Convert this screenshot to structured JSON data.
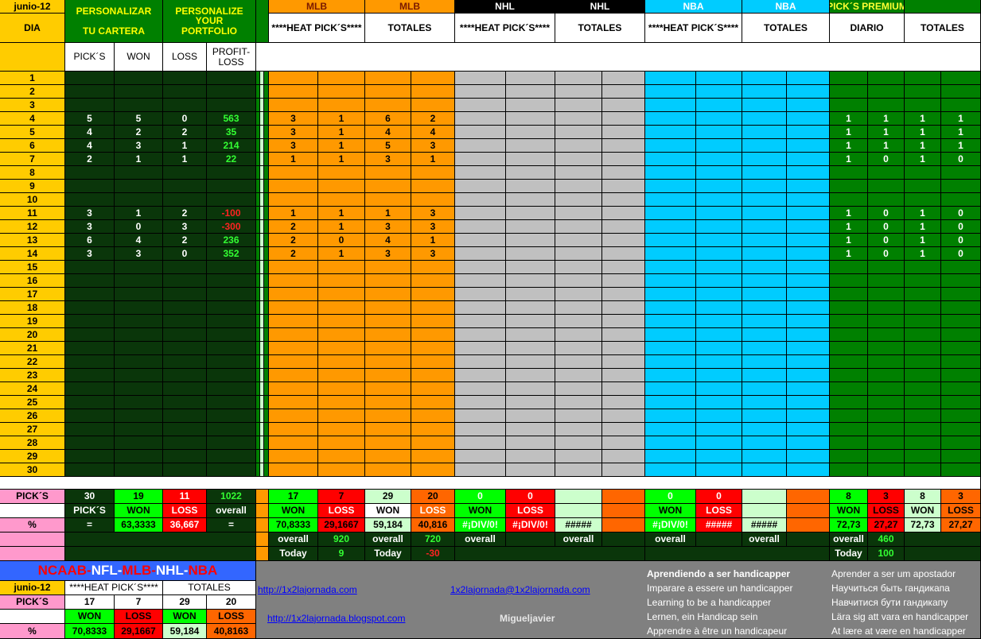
{
  "header": {
    "month": "junio-12",
    "dia": "DIA",
    "personalizar": [
      "PERSONALIZAR",
      "TU CARTERA"
    ],
    "personalize": [
      "PERSONALIZE",
      "YOUR",
      "PORTFOLIO"
    ],
    "sections": [
      {
        "label": "MLB",
        "sub": "****HEAT PICK´S****"
      },
      {
        "label": "MLB",
        "sub": "TOTALES"
      },
      {
        "label": "NHL",
        "sub": "****HEAT PICK´S****"
      },
      {
        "label": "NHL",
        "sub": "TOTALES"
      },
      {
        "label": "NBA",
        "sub": "****HEAT PICK´S****"
      },
      {
        "label": "NBA",
        "sub": "TOTALES"
      },
      {
        "label": "PICK´S  PREMIUM",
        "sub": "DIARIO"
      },
      {
        "label": "",
        "sub": "TOTALES"
      }
    ],
    "cols": [
      "PICK´S",
      "WON",
      "LOSS",
      "PROFIT-LOSS"
    ]
  },
  "days": [
    "1",
    "2",
    "3",
    "4",
    "5",
    "6",
    "7",
    "8",
    "9",
    "10",
    "11",
    "12",
    "13",
    "14",
    "15",
    "16",
    "17",
    "18",
    "19",
    "20",
    "21",
    "22",
    "23",
    "24",
    "25",
    "26",
    "27",
    "28",
    "29",
    "30"
  ],
  "portfolio": {
    "4": [
      "5",
      "5",
      "0",
      "563"
    ],
    "5": [
      "4",
      "2",
      "2",
      "35"
    ],
    "6": [
      "4",
      "3",
      "1",
      "214"
    ],
    "7": [
      "2",
      "1",
      "1",
      "22"
    ],
    "11": [
      "3",
      "1",
      "2",
      "-100"
    ],
    "12": [
      "3",
      "0",
      "3",
      "-300"
    ],
    "13": [
      "6",
      "4",
      "2",
      "236"
    ],
    "14": [
      "3",
      "3",
      "0",
      "352"
    ]
  },
  "mlb": {
    "4": [
      "3",
      "1",
      "6",
      "2"
    ],
    "5": [
      "3",
      "1",
      "4",
      "4"
    ],
    "6": [
      "3",
      "1",
      "5",
      "3"
    ],
    "7": [
      "1",
      "1",
      "3",
      "1"
    ],
    "11": [
      "1",
      "1",
      "1",
      "3"
    ],
    "12": [
      "2",
      "1",
      "3",
      "3"
    ],
    "13": [
      "2",
      "0",
      "4",
      "1"
    ],
    "14": [
      "2",
      "1",
      "3",
      "3"
    ]
  },
  "premium": {
    "4": [
      "1",
      "1",
      "1",
      "1"
    ],
    "5": [
      "1",
      "1",
      "1",
      "1"
    ],
    "6": [
      "1",
      "1",
      "1",
      "1"
    ],
    "7": [
      "1",
      "0",
      "1",
      "0"
    ],
    "11": [
      "1",
      "0",
      "1",
      "0"
    ],
    "12": [
      "1",
      "0",
      "1",
      "0"
    ],
    "13": [
      "1",
      "0",
      "1",
      "0"
    ],
    "14": [
      "1",
      "0",
      "1",
      "0"
    ]
  },
  "summary": {
    "picks_label": "PICK´S",
    "totals": [
      "30",
      "19",
      "11",
      "1022"
    ],
    "picks": "PICK´S",
    "won": "WON",
    "loss": "LOSS",
    "overall": "overall",
    "pct": "%",
    "eq": "=",
    "won_pct": "63,3333",
    "loss_pct": "36,667",
    "mlb_heat": [
      "17",
      "7"
    ],
    "mlb_tot": [
      "29",
      "20"
    ],
    "mlb_heat_pct": [
      "70,8333",
      "29,1667"
    ],
    "mlb_tot_pct": [
      "59,184",
      "40,816"
    ],
    "mlb_heat_overall": "920",
    "mlb_tot_overall": "720",
    "mlb_heat_today": "9",
    "mlb_tot_today": "-30",
    "today": "Today",
    "nhl": [
      "0",
      "0"
    ],
    "div": "#¡DIV/0!",
    "hash": "#####",
    "prem_d": [
      "8",
      "3"
    ],
    "prem_t": [
      "8",
      "3"
    ],
    "prem_d_pct": [
      "72,73",
      "27,27"
    ],
    "prem_t_pct": [
      "72,73",
      "27,27"
    ],
    "prem_overall": "460",
    "prem_today": "100"
  },
  "footer": {
    "title": [
      "NCAAB-",
      "NFL-",
      "MLB-",
      "NHL-",
      "NBA"
    ],
    "month": "junio-12",
    "heat": "****HEAT PICK´S****",
    "totales": "TOTALES",
    "picks": "PICK´S",
    "vals": [
      "17",
      "7",
      "29",
      "20"
    ],
    "won": "WON",
    "loss": "LOSS",
    "pct": "%",
    "pcts": [
      "70,8333",
      "29,1667",
      "59,184",
      "40,8163"
    ],
    "link1": "http://1x2lajornada.com",
    "email": "1x2lajornada@1x2lajornada.com",
    "link2": "http://1x2lajornada.blogspot.com",
    "author": "Migueljavier",
    "phrases1": [
      "Aprendiendo a ser handicapper",
      "Imparare a essere un handicapper",
      "Learning to be a handicapper",
      "Lernen, ein Handicap sein",
      "Apprendre à être un handicapeur"
    ],
    "phrases2": [
      "Aprender a ser um apostador",
      "Научиться быть гандикапа",
      "Навчитися бути гандикапу",
      "Lära sig att vara en handicapper",
      "At lære at være en handicapper"
    ]
  },
  "colors": {
    "orange": "#ff9900",
    "gray": "#c0c0c0",
    "cyan": "#00ccff",
    "green": "#008000",
    "dark": "#0a360a",
    "yellow": "#ffcc00"
  }
}
